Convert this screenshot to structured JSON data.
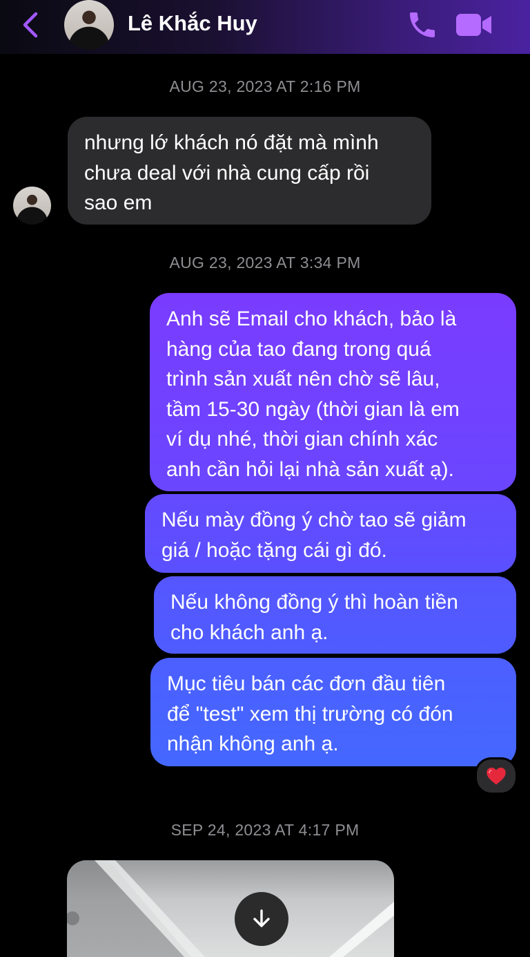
{
  "header": {
    "contact_name": "Lê Khắc Huy",
    "back_icon": "chevron-left-icon",
    "call_icon": "phone-icon",
    "video_icon": "video-camera-icon",
    "accent_color": "#a259ff"
  },
  "thread": {
    "timestamps": [
      "AUG 23, 2023 AT 2:16 PM",
      "AUG 23, 2023 AT 3:34 PM",
      "SEP 24, 2023 AT 4:17 PM"
    ],
    "incoming": [
      "nhưng lớ khách nó đặt mà mình\nchưa deal với nhà cung cấp rồi\nsao em"
    ],
    "outgoing": [
      "Anh sẽ Email cho khách, bảo là\nhàng của tao đang trong quá\ntrình sản xuất nên chờ sẽ lâu,\ntầm 15-30 ngày (thời gian là em\nví dụ nhé, thời gian chính xác\nanh cần hỏi lại nhà sản xuất ạ).",
      "Nếu mày đồng ý chờ tao sẽ giảm\ngiá / hoặc tặng cái gì đó.",
      "Nếu không đồng ý thì hoàn tiền\ncho khách anh ạ.",
      "Mục tiêu bán các đơn đầu tiên\nđể \"test\" xem thị trường có đón\nnhận không anh ạ."
    ],
    "reaction": "❤️",
    "attachment_icon": "download-arrow-icon"
  }
}
